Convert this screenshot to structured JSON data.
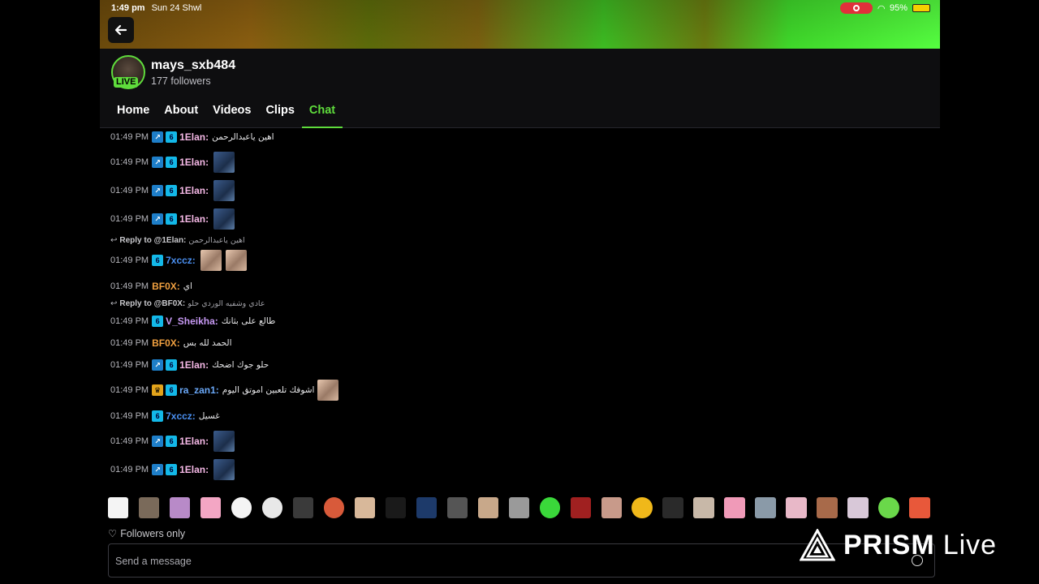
{
  "status_bar": {
    "time": "1:49 pm",
    "date": "Sun 24 Shwl",
    "battery": "95%"
  },
  "channel": {
    "username": "mays_sxb484",
    "followers": "177 followers",
    "live_label": "LIVE"
  },
  "tabs": [
    {
      "label": "Home"
    },
    {
      "label": "About"
    },
    {
      "label": "Videos"
    },
    {
      "label": "Clips"
    },
    {
      "label": "Chat"
    }
  ],
  "active_tab": "Chat",
  "colors": {
    "accent": "#5fdc3c",
    "user_pink": "#f5b8e6",
    "user_blue": "#4a8ff0",
    "user_orange": "#f0a040",
    "user_purple": "#c89af5"
  },
  "chat": {
    "messages": [
      {
        "time": "01:49 PM",
        "user": "1Elan:",
        "text": "اهين ياعبدالرحمن"
      },
      {
        "time": "01:49 PM",
        "user": "1Elan:",
        "text": ""
      },
      {
        "time": "01:49 PM",
        "user": "1Elan:",
        "text": ""
      },
      {
        "time": "01:49 PM",
        "user": "1Elan:",
        "text": ""
      },
      {
        "time": "01:49 PM",
        "user": "7xccz:",
        "text": ""
      },
      {
        "time": "01:49 PM",
        "user": "BF0X:",
        "text": "اي"
      },
      {
        "time": "01:49 PM",
        "user": "V_Sheikha:",
        "text": "طالع على بثانك"
      },
      {
        "time": "01:49 PM",
        "user": "BF0X:",
        "text": "الحمد لله بس"
      },
      {
        "time": "01:49 PM",
        "user": "1Elan:",
        "text": "حلو جوك اضحك"
      },
      {
        "time": "01:49 PM",
        "user": "ra_zan1:",
        "text": "اشوفك تلعبين اموتق اليوم"
      },
      {
        "time": "01:49 PM",
        "user": "7xccz:",
        "text": "غسيل"
      },
      {
        "time": "01:49 PM",
        "user": "1Elan:",
        "text": ""
      },
      {
        "time": "01:49 PM",
        "user": "1Elan:",
        "text": ""
      }
    ],
    "replies": [
      {
        "label": "Reply to @1Elan:",
        "text": "اهين ياعبدالرحمن"
      },
      {
        "label": "Reply to @BF0X:",
        "text": "عادي وشفيه الوردي حلو"
      }
    ]
  },
  "footer": {
    "followers_only": "Followers only",
    "message_placeholder": "Send a message",
    "watermark_brand": "PRISM",
    "watermark_live": "Live"
  }
}
